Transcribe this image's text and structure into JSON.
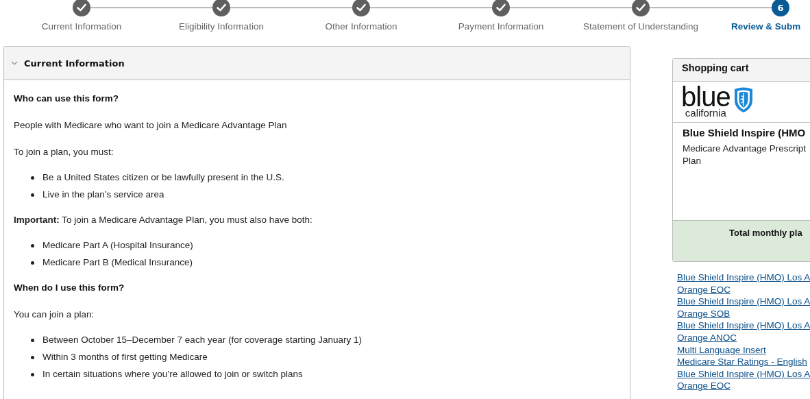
{
  "steps": [
    {
      "label": "Current Information",
      "completed": true,
      "selected": false
    },
    {
      "label": "Eligibility Information",
      "completed": true,
      "selected": false
    },
    {
      "label": "Other Information",
      "completed": true,
      "selected": false
    },
    {
      "label": "Payment Information",
      "completed": true,
      "selected": false
    },
    {
      "label": "Statement of Understanding",
      "completed": true,
      "selected": false
    },
    {
      "label": "Review & Subm",
      "number": "6",
      "completed": false,
      "selected": true
    }
  ],
  "section": {
    "title": "Current Information",
    "expanded": true,
    "blocks": [
      {
        "kind": "heading",
        "text": "Who can use this form?"
      },
      {
        "kind": "para",
        "text": "People with Medicare who want to join a Medicare Advantage Plan"
      },
      {
        "kind": "para",
        "text": "To join a plan, you must:"
      },
      {
        "kind": "list",
        "items": [
          "Be a United States citizen or be lawfully present in the U.S.",
          "Live in the plan’s service area"
        ]
      },
      {
        "kind": "para",
        "text": "**Important:** To join a Medicare Advantage Plan, you must also have both:"
      },
      {
        "kind": "list",
        "items": [
          "Medicare Part A (Hospital Insurance)",
          "Medicare Part B (Medical Insurance)"
        ]
      },
      {
        "kind": "heading",
        "text": "When do I use this form?"
      },
      {
        "kind": "para",
        "text": "You can join a plan:"
      },
      {
        "kind": "list",
        "items": [
          "Between October 15–December 7 each year (for coverage starting January 1)",
          "Within 3 months of first getting Medicare",
          "In certain situations where you’re allowed to join or switch plans"
        ]
      }
    ]
  },
  "cart": {
    "title": "Shopping cart",
    "logo": {
      "word": "blue",
      "region": "california"
    },
    "plan_name": "Blue Shield Inspire (HMO",
    "plan_type": "Medicare Advantage Prescript",
    "plan_type_2": "Plan",
    "total_label": "Total monthly pla",
    "links": [
      "Blue Shield Inspire (HMO) Los A",
      "Orange EOC",
      "Blue Shield Inspire (HMO) Los A",
      "Orange SOB",
      "Blue Shield Inspire (HMO) Los A",
      "Orange ANOC",
      "Multi Language Insert",
      "Medicare Star Ratings - English",
      "Blue Shield Inspire (HMO) Los A",
      "Orange EOC"
    ]
  }
}
